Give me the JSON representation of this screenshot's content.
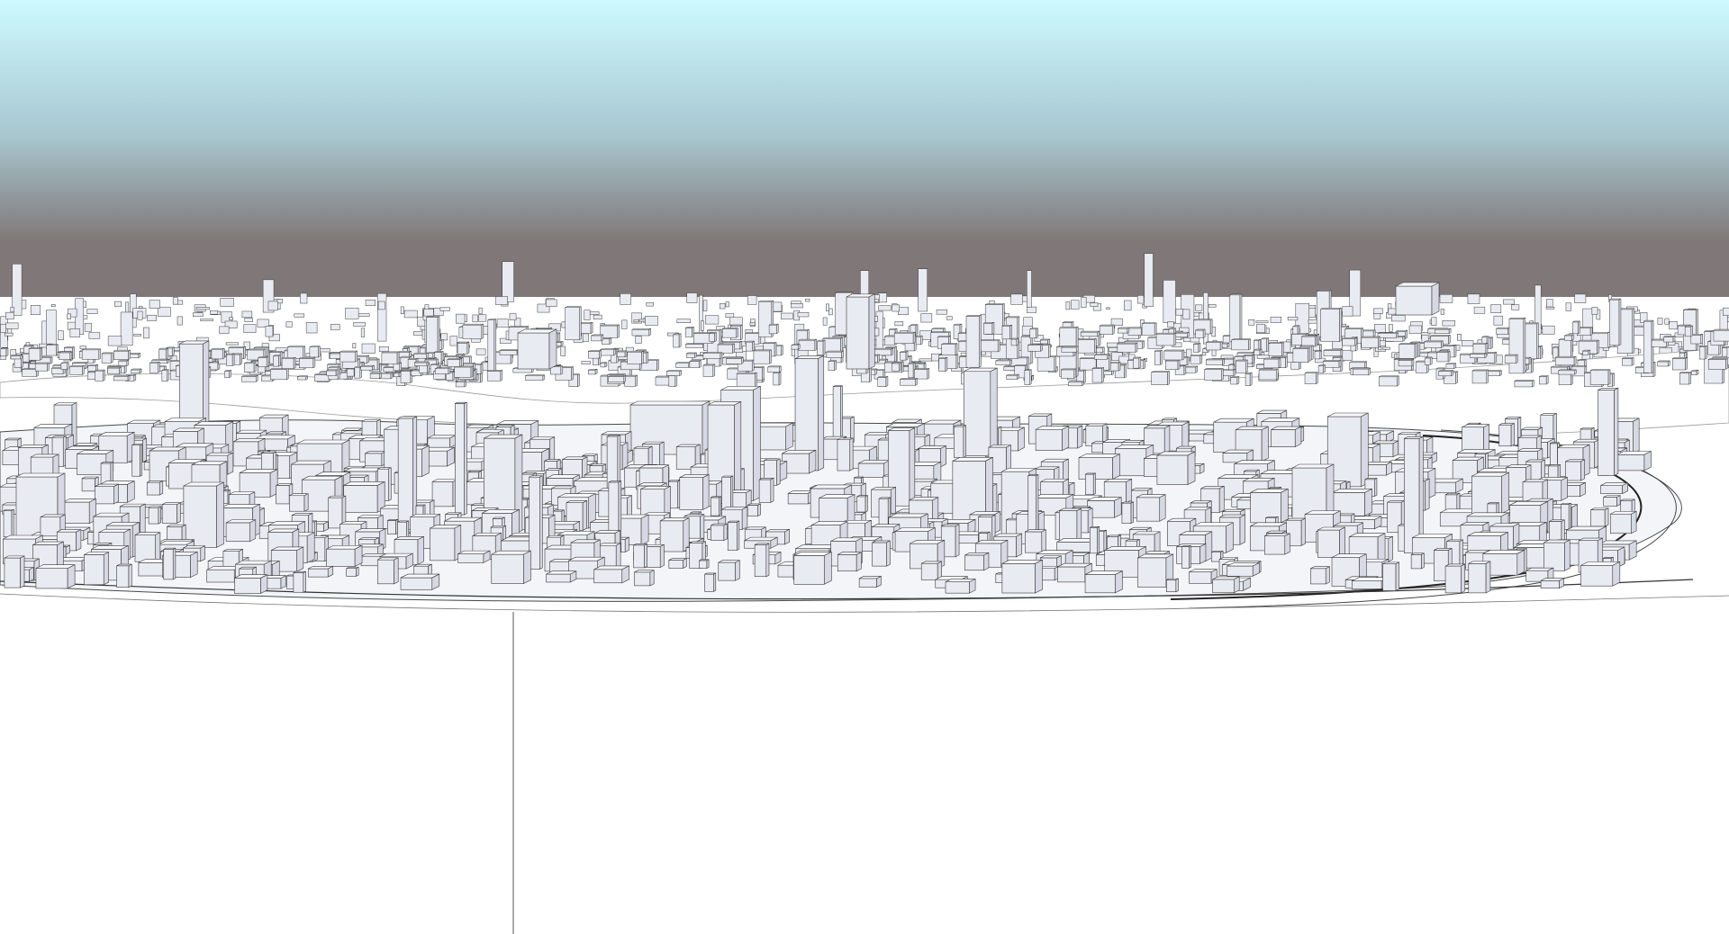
{
  "viewport": {
    "sky_colors": {
      "top": "#cdfaff",
      "mid": "#a8c7cf",
      "horizon": "#807878"
    },
    "ground_color": "#ffffff",
    "water_color": "#ffffff",
    "building_fill": "#e9ebf2",
    "building_stroke": "#3a3a3a",
    "model_style": "monochrome-3d-city-massing"
  }
}
